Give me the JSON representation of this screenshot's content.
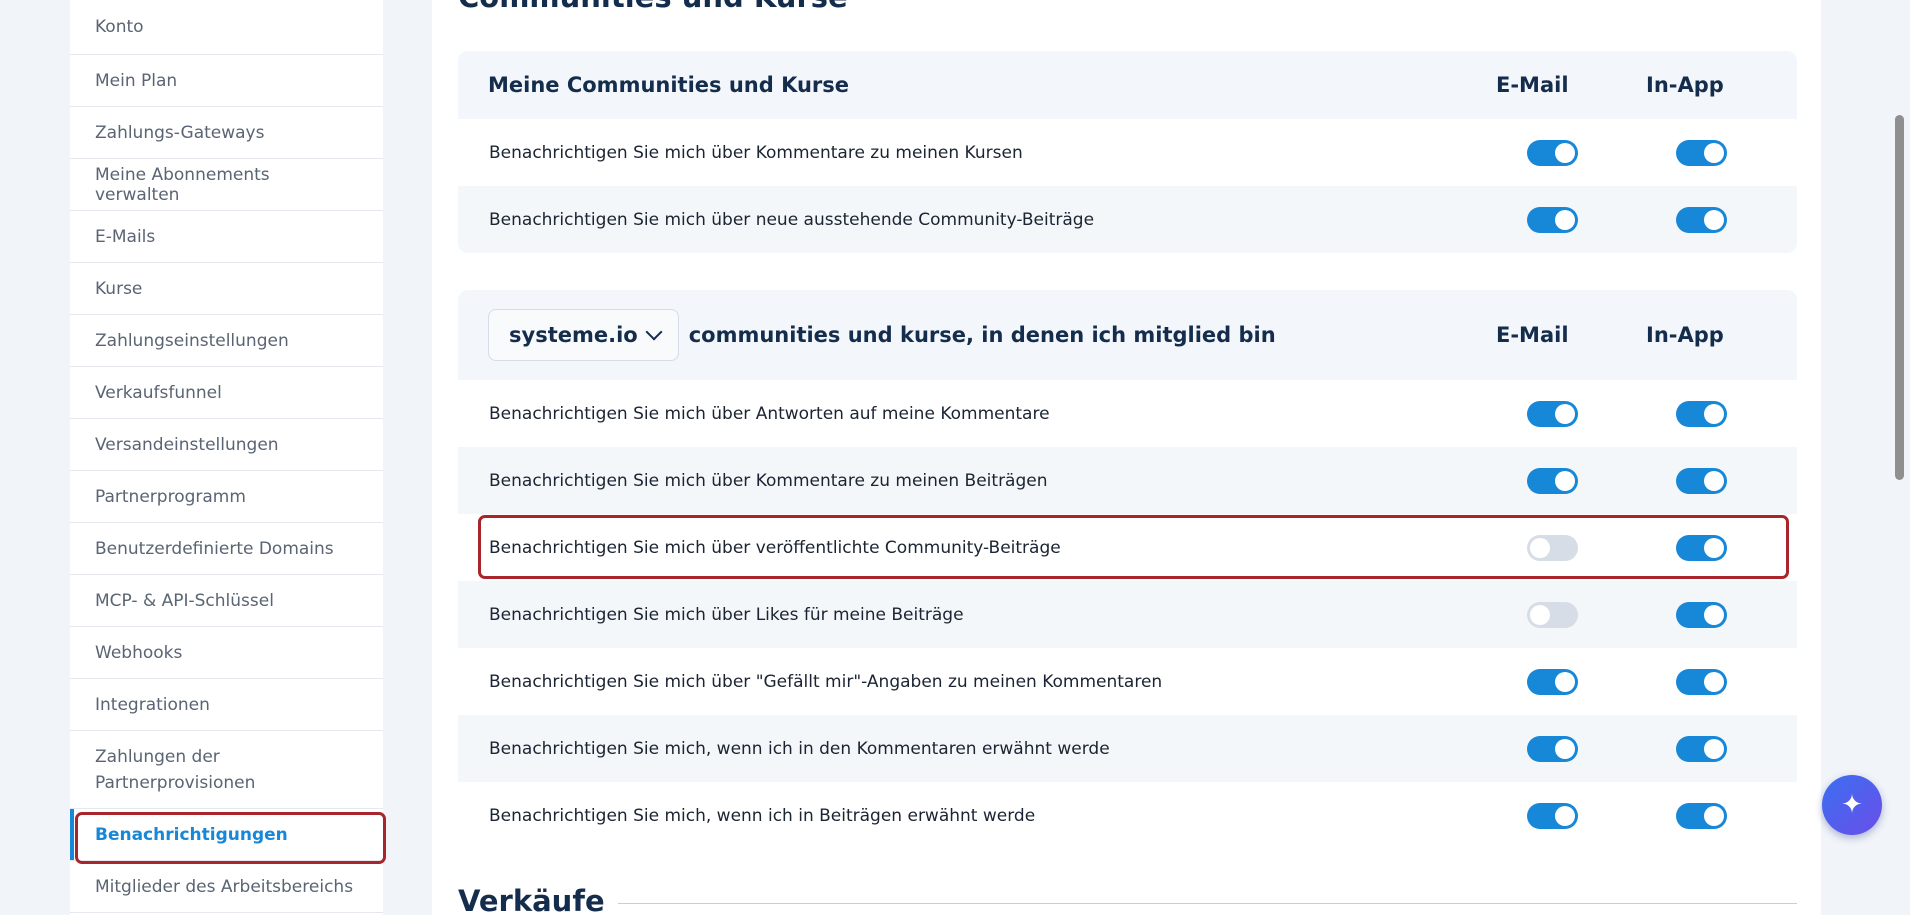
{
  "sidebar": {
    "items": [
      {
        "label": "Konto"
      },
      {
        "label": "Mein Plan"
      },
      {
        "label": "Zahlungs-Gateways"
      },
      {
        "label": "Meine Abonnements verwalten"
      },
      {
        "label": "E-Mails"
      },
      {
        "label": "Kurse"
      },
      {
        "label": "Zahlungseinstellungen"
      },
      {
        "label": "Verkaufsfunnel"
      },
      {
        "label": "Versandeinstellungen"
      },
      {
        "label": "Partnerprogramm"
      },
      {
        "label": "Benutzerdefinierte Domains"
      },
      {
        "label": "MCP- & API-Schlüssel"
      },
      {
        "label": "Webhooks"
      },
      {
        "label": "Integrationen"
      },
      {
        "label": "Zahlungen der Partnerprovisionen"
      },
      {
        "label": "Benachrichtigungen"
      },
      {
        "label": "Mitglieder des Arbeitsbereichs"
      }
    ],
    "active": "Benachrichtigungen"
  },
  "main": {
    "section_title": "Communities und Kurse",
    "bottom_section_title": "Verkäufe",
    "group1": {
      "title": "Meine Communities und Kurse",
      "col_email": "E-Mail",
      "col_inapp": "In-App",
      "rows": [
        {
          "label": "Benachrichtigen Sie mich über Kommentare zu meinen Kursen",
          "email": true,
          "inapp": true
        },
        {
          "label": "Benachrichtigen Sie mich über neue ausstehende Community-Beiträge",
          "email": true,
          "inapp": true
        }
      ]
    },
    "group2": {
      "dropdown_value": "systeme.io",
      "title": "communities und kurse, in denen ich mitglied bin",
      "col_email": "E-Mail",
      "col_inapp": "In-App",
      "rows": [
        {
          "label": "Benachrichtigen Sie mich über Antworten auf meine Kommentare",
          "email": true,
          "inapp": true
        },
        {
          "label": "Benachrichtigen Sie mich über Kommentare zu meinen Beiträgen",
          "email": true,
          "inapp": true
        },
        {
          "label": "Benachrichtigen Sie mich über veröffentlichte Community-Beiträge",
          "email": false,
          "inapp": true
        },
        {
          "label": "Benachrichtigen Sie mich über Likes für meine Beiträge",
          "email": false,
          "inapp": true
        },
        {
          "label": "Benachrichtigen Sie mich über \"Gefällt mir\"-Angaben zu meinen Kommentaren",
          "email": true,
          "inapp": true
        },
        {
          "label": "Benachrichtigen Sie mich, wenn ich in den Kommentaren erwähnt werde",
          "email": true,
          "inapp": true
        },
        {
          "label": "Benachrichtigen Sie mich, wenn ich in Beiträgen erwähnt werde",
          "email": true,
          "inapp": true
        }
      ]
    }
  },
  "icons": {
    "ai_button": "sparkles-icon",
    "dropdown": "chevron-down-icon"
  },
  "colors": {
    "accent": "#1787d8",
    "highlight": "#a8262b",
    "toggle_off": "#d6dde6"
  }
}
